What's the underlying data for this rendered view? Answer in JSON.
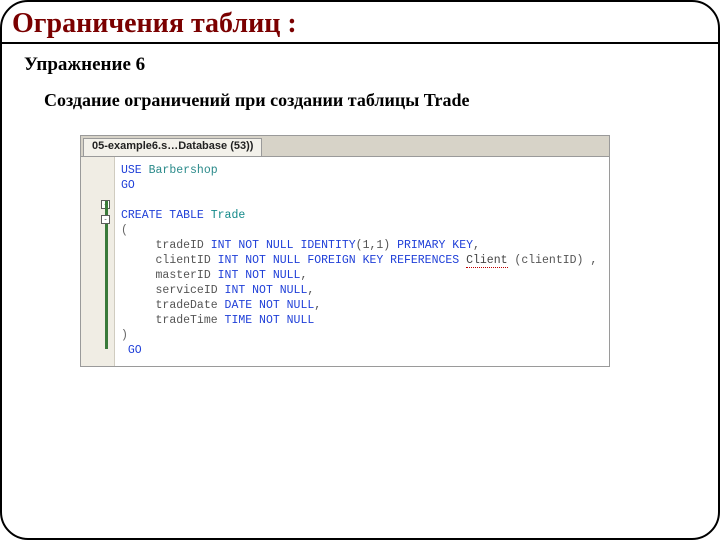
{
  "title": "Ограничения таблиц :",
  "subtitle": "Упражнение 6",
  "description": "Создание ограничений при создании таблицы Trade",
  "editor": {
    "tab_label": "05-example6.s…Database (53))",
    "code": {
      "line1_use": "USE",
      "line1_db": "Barbershop",
      "line2_go": "GO",
      "line4_create": "CREATE TABLE",
      "line4_table": "Trade",
      "line5_open": "(",
      "line6_col": "tradeID",
      "line6_type": "INT NOT NULL IDENTITY",
      "line6_args": "(1,1)",
      "line6_pk": "PRIMARY KEY",
      "line6_end": ",",
      "line7_col": "clientID",
      "line7_type": "INT NOT NULL FOREIGN KEY REFERENCES",
      "line7_ref": "Client",
      "line7_args": "(clientID)",
      "line7_end": ",",
      "line8_col": "masterID",
      "line8_type": "INT NOT NULL",
      "line8_end": ",",
      "line9_col": "serviceID",
      "line9_type": "INT NOT NULL",
      "line9_end": ",",
      "line10_col": "tradeDate",
      "line10_type": "DATE NOT NULL",
      "line10_end": ",",
      "line11_col": "tradeTime",
      "line11_type": "TIME NOT NULL",
      "line12_close": ")",
      "line13_go": "GO"
    }
  }
}
